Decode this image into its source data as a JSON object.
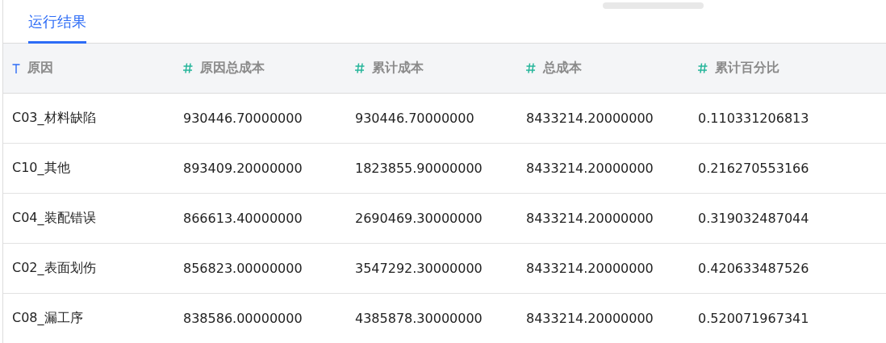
{
  "tabs": [
    {
      "label": "运行结果",
      "selected": true
    }
  ],
  "table": {
    "columns": [
      {
        "label": "原因",
        "kind": "text"
      },
      {
        "label": "原因总成本",
        "kind": "number"
      },
      {
        "label": "累计成本",
        "kind": "number"
      },
      {
        "label": "总成本",
        "kind": "number"
      },
      {
        "label": "累计百分比",
        "kind": "number"
      }
    ],
    "rows": [
      [
        "C03_材料缺陷",
        "930446.70000000",
        "930446.70000000",
        "8433214.20000000",
        "0.110331206813"
      ],
      [
        "C10_其他",
        "893409.20000000",
        "1823855.90000000",
        "8433214.20000000",
        "0.216270553166"
      ],
      [
        "C04_装配错误",
        "866613.40000000",
        "2690469.30000000",
        "8433214.20000000",
        "0.319032487044"
      ],
      [
        "C02_表面划伤",
        "856823.00000000",
        "3547292.30000000",
        "8433214.20000000",
        "0.420633487526"
      ],
      [
        "C08_漏工序",
        "838586.00000000",
        "4385878.30000000",
        "8433214.20000000",
        "0.520071967341"
      ]
    ]
  }
}
